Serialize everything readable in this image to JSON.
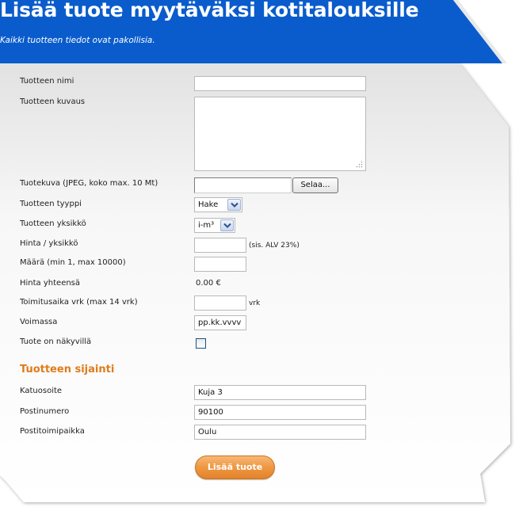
{
  "header": {
    "title": "Lisää tuote myytäväksi kotitalouksille",
    "subtitle": "Kaikki tuotteen tiedot ovat pakollisia."
  },
  "form": {
    "product_name_label": "Tuotteen nimi",
    "product_name_value": "",
    "description_label": "Tuotteen kuvaus",
    "description_value": "",
    "image_label": "Tuotekuva (JPEG, koko max. 10 Mt)",
    "browse_label": "Selaa...",
    "type_label": "Tuotteen tyyppi",
    "type_selected": "Hake",
    "unit_label": "Tuotteen yksikkö",
    "unit_selected": "i-m³",
    "price_label": "Hinta / yksikkö",
    "price_value": "",
    "price_suffix": "(sis. ALV 23%)",
    "quantity_label": "Määrä (min 1, max 10000)",
    "quantity_value": "",
    "total_label": "Hinta yhteensä",
    "total_value": "0.00 €",
    "delivery_label": "Toimitusaika vrk (max 14 vrk)",
    "delivery_value": "",
    "delivery_suffix": "vrk",
    "valid_label": "Voimassa",
    "valid_value": "pp.kk.vvvv",
    "visible_label": "Tuote on näkyvillä",
    "visible_checked": false
  },
  "location": {
    "heading": "Tuotteen sijainti",
    "street_label": "Katuosoite",
    "street_value": "Kuja 3",
    "postcode_label": "Postinumero",
    "postcode_value": "90100",
    "city_label": "Postitoimipaikka",
    "city_value": "Oulu"
  },
  "submit_label": "Lisää tuote",
  "colors": {
    "header_blue": "#0a5ccc",
    "accent_orange": "#e07b1a"
  }
}
